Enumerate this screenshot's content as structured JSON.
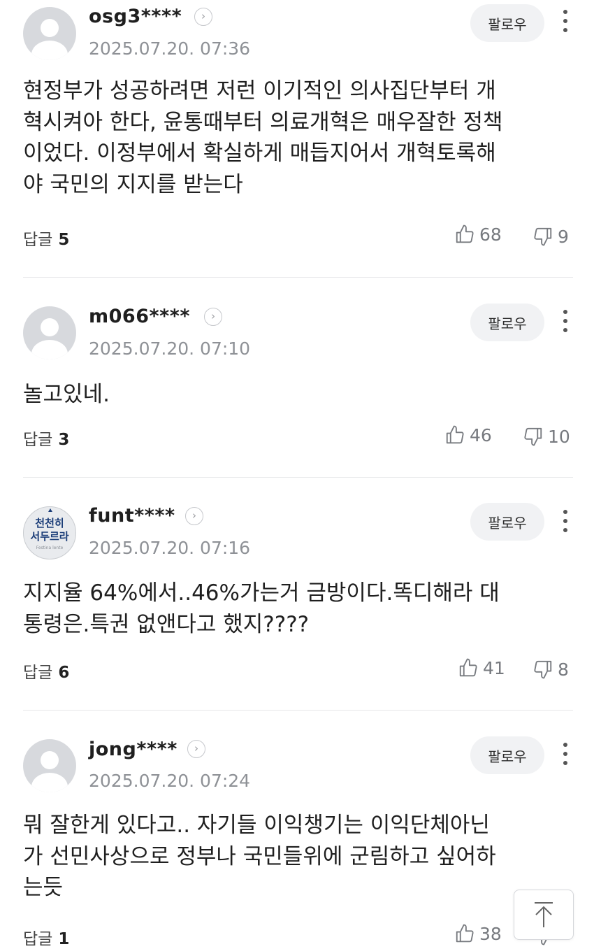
{
  "follow_label": "팔로우",
  "reply_label": "답글",
  "comments": [
    {
      "username": "osg3****",
      "date": "2025.07.20. 07:36",
      "text": "현정부가 성공하려면 저런 이기적인 의사집단부터 개\n혁시켜아 한다, 윤통때부터 의료개혁은 매우잘한 정책\n이었다. 이정부에서 확실하게 매듭지어서 개혁토록해\n야 국민의 지지를 받는다",
      "replies": "5",
      "likes": "68",
      "dislikes": "9"
    },
    {
      "username": "m066****",
      "date": "2025.07.20. 07:10",
      "text": "놀고있네.",
      "replies": "3",
      "likes": "46",
      "dislikes": "10"
    },
    {
      "username": "funt****",
      "date": "2025.07.20. 07:16",
      "avatar_text": [
        "천천히",
        "서두르라"
      ],
      "avatar_sub": "Festina lente",
      "text": "지지율 64%에서..46%가는거 금방이다.똑디해라 대\n통령은.특권 없앤다고 했지????",
      "replies": "6",
      "likes": "41",
      "dislikes": "8"
    },
    {
      "username": "jong****",
      "date": "2025.07.20. 07:24",
      "text": "뭐 잘한게 있다고.. 자기들 이익챙기는 이익단체아닌\n가 선민사상으로 정부나 국민들위에 군림하고 싶어하\n는듯",
      "replies": "1",
      "likes": "38",
      "dislikes": ""
    }
  ]
}
